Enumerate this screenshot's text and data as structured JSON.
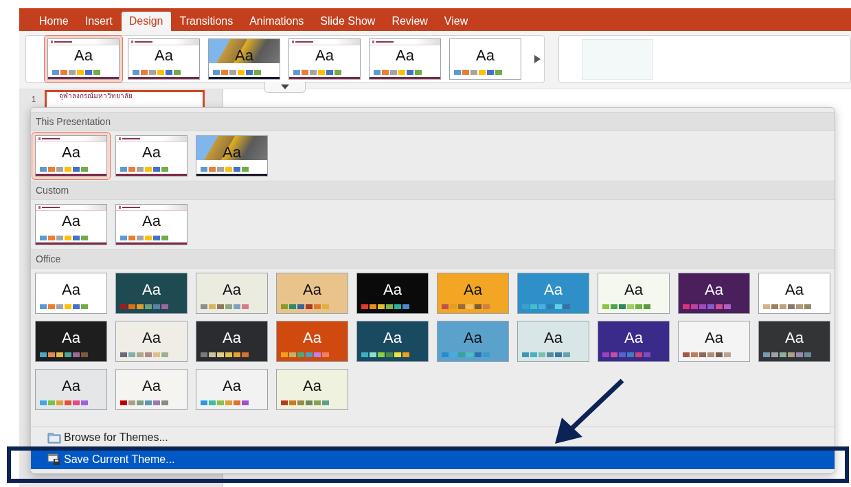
{
  "tabs": [
    {
      "label": "Home",
      "selected": false
    },
    {
      "label": "Insert",
      "selected": false
    },
    {
      "label": "Design",
      "selected": true
    },
    {
      "label": "Transitions",
      "selected": false
    },
    {
      "label": "Animations",
      "selected": false
    },
    {
      "label": "Slide Show",
      "selected": false
    },
    {
      "label": "Review",
      "selected": false
    },
    {
      "label": "View",
      "selected": false
    }
  ],
  "ribbon": {
    "themes": [
      {
        "label": "Aa",
        "kind": "template",
        "color": "#ffffff",
        "palette": [
          {
            "color": "#5b9bd5"
          },
          {
            "color": "#ed7d31"
          },
          {
            "color": "#a5a5a5"
          },
          {
            "color": "#ffc000"
          },
          {
            "color": "#4472c4"
          },
          {
            "color": "#70ad47"
          }
        ],
        "selected": true
      },
      {
        "label": "Aa",
        "kind": "template",
        "color": "#ffffff",
        "palette": [
          {
            "color": "#5b9bd5"
          },
          {
            "color": "#ed7d31"
          },
          {
            "color": "#a5a5a5"
          },
          {
            "color": "#ffc000"
          },
          {
            "color": "#4472c4"
          },
          {
            "color": "#70ad47"
          }
        ],
        "selected": false
      },
      {
        "label": "Aa",
        "kind": "photo",
        "palette": [
          {
            "color": "#5b9bd5"
          },
          {
            "color": "#ed7d31"
          },
          {
            "color": "#a5a5a5"
          },
          {
            "color": "#ffc000"
          },
          {
            "color": "#4472c4"
          },
          {
            "color": "#70ad47"
          }
        ],
        "selected": false
      },
      {
        "label": "Aa",
        "kind": "template",
        "color": "#ffffff",
        "palette": [
          {
            "color": "#5b9bd5"
          },
          {
            "color": "#ed7d31"
          },
          {
            "color": "#a5a5a5"
          },
          {
            "color": "#ffc000"
          },
          {
            "color": "#4472c4"
          },
          {
            "color": "#70ad47"
          }
        ],
        "selected": false
      },
      {
        "label": "Aa",
        "kind": "template",
        "color": "#ffffff",
        "palette": [
          {
            "color": "#5b9bd5"
          },
          {
            "color": "#ed7d31"
          },
          {
            "color": "#a5a5a5"
          },
          {
            "color": "#ffc000"
          },
          {
            "color": "#4472c4"
          },
          {
            "color": "#70ad47"
          }
        ],
        "selected": false
      },
      {
        "label": "Aa",
        "kind": "plain",
        "color": "#ffffff",
        "palette": [
          {
            "color": "#5b9bd5"
          },
          {
            "color": "#ed7d31"
          },
          {
            "color": "#a5a5a5"
          },
          {
            "color": "#ffc000"
          },
          {
            "color": "#4472c4"
          },
          {
            "color": "#70ad47"
          }
        ],
        "selected": false
      }
    ]
  },
  "slide_panel": {
    "number": "1",
    "slide_title": "จุฬาลงกรณ์มหาวิทยาลัย"
  },
  "theme_gallery": {
    "sections": [
      {
        "title": "This Presentation",
        "themes": [
          {
            "label": "Aa",
            "kind": "template",
            "color": "#ffffff",
            "palette": [
              {
                "color": "#5b9bd5"
              },
              {
                "color": "#ed7d31"
              },
              {
                "color": "#a5a5a5"
              },
              {
                "color": "#ffc000"
              },
              {
                "color": "#4472c4"
              },
              {
                "color": "#70ad47"
              }
            ],
            "selected": true
          },
          {
            "label": "Aa",
            "kind": "template",
            "color": "#ffffff",
            "palette": [
              {
                "color": "#5b9bd5"
              },
              {
                "color": "#ed7d31"
              },
              {
                "color": "#a5a5a5"
              },
              {
                "color": "#ffc000"
              },
              {
                "color": "#4472c4"
              },
              {
                "color": "#70ad47"
              }
            ],
            "selected": false
          },
          {
            "label": "Aa",
            "kind": "photo",
            "palette": [
              {
                "color": "#5b9bd5"
              },
              {
                "color": "#ed7d31"
              },
              {
                "color": "#a5a5a5"
              },
              {
                "color": "#ffc000"
              },
              {
                "color": "#4472c4"
              },
              {
                "color": "#70ad47"
              }
            ],
            "selected": false
          }
        ]
      },
      {
        "title": "Custom",
        "themes": [
          {
            "label": "Aa",
            "kind": "template",
            "color": "#ffffff",
            "palette": [
              {
                "color": "#5b9bd5"
              },
              {
                "color": "#ed7d31"
              },
              {
                "color": "#a5a5a5"
              },
              {
                "color": "#ffc000"
              },
              {
                "color": "#4472c4"
              },
              {
                "color": "#70ad47"
              }
            ],
            "selected": false
          },
          {
            "label": "Aa",
            "kind": "template",
            "color": "#ffffff",
            "palette": [
              {
                "color": "#5b9bd5"
              },
              {
                "color": "#ed7d31"
              },
              {
                "color": "#a5a5a5"
              },
              {
                "color": "#ffc000"
              },
              {
                "color": "#4472c4"
              },
              {
                "color": "#70ad47"
              }
            ],
            "selected": false
          }
        ]
      },
      {
        "title": "Office",
        "themes": [
          {
            "label": "Aa",
            "kind": "plain",
            "color": "#ffffff",
            "palette": [
              {
                "color": "#5b9bd5"
              },
              {
                "color": "#ed7d31"
              },
              {
                "color": "#a5a5a5"
              },
              {
                "color": "#ffc000"
              },
              {
                "color": "#4472c4"
              },
              {
                "color": "#70ad47"
              }
            ],
            "selected": false
          },
          {
            "label": "Aa",
            "kind": "plain",
            "color": "#1e4a52",
            "palette": [
              {
                "color": "#a31c1c"
              },
              {
                "color": "#e46c0a"
              },
              {
                "color": "#d8a02a"
              },
              {
                "color": "#6aa37b"
              },
              {
                "color": "#5b82a1"
              },
              {
                "color": "#a463a3"
              }
            ],
            "selected": false
          },
          {
            "label": "Aa",
            "kind": "plain",
            "color": "#ecebe0",
            "palette": [
              {
                "color": "#8e8e8e"
              },
              {
                "color": "#dbb35f"
              },
              {
                "color": "#8c7a5b"
              },
              {
                "color": "#8fa77f"
              },
              {
                "color": "#7ea2bf"
              },
              {
                "color": "#d97a8a"
              }
            ],
            "selected": false
          },
          {
            "label": "Aa",
            "kind": "plain",
            "color": "#e8c48c",
            "palette": [
              {
                "color": "#8c9a2a"
              },
              {
                "color": "#2f8a6b"
              },
              {
                "color": "#3b63a0"
              },
              {
                "color": "#a93a2a"
              },
              {
                "color": "#e07a2a"
              },
              {
                "color": "#e0b040"
              }
            ],
            "selected": false
          },
          {
            "label": "Aa",
            "kind": "plain",
            "color": "#0a0a0a",
            "palette": [
              {
                "color": "#e23b2b"
              },
              {
                "color": "#f28a1a"
              },
              {
                "color": "#e0c02a"
              },
              {
                "color": "#7ab94a"
              },
              {
                "color": "#2ab0a0"
              },
              {
                "color": "#4a8ad0"
              }
            ],
            "selected": false
          },
          {
            "label": "Aa",
            "kind": "plain",
            "color": "#f2a623",
            "palette": [
              {
                "color": "#c0504d"
              },
              {
                "color": "#e0a020"
              },
              {
                "color": "#9a6a3a"
              },
              {
                "color": "#f0c060"
              },
              {
                "color": "#7a5a3a"
              },
              {
                "color": "#d08040"
              }
            ],
            "selected": false
          },
          {
            "label": "Aa",
            "kind": "plain",
            "color": "#2f8fc8",
            "palette": [
              {
                "color": "#3aa0d0"
              },
              {
                "color": "#40c0c0"
              },
              {
                "color": "#4ab0e0"
              },
              {
                "color": "#2a80b0"
              },
              {
                "color": "#60d0e0"
              },
              {
                "color": "#3a70a0"
              }
            ],
            "selected": false
          },
          {
            "label": "Aa",
            "kind": "plain",
            "color": "#f4f8ee",
            "palette": [
              {
                "color": "#8cc63f"
              },
              {
                "color": "#4aa84a"
              },
              {
                "color": "#2a8a5a"
              },
              {
                "color": "#a0d060"
              },
              {
                "color": "#70b040"
              },
              {
                "color": "#5a9a3a"
              }
            ],
            "selected": false
          },
          {
            "label": "Aa",
            "kind": "plain",
            "color": "#4a1f5c",
            "palette": [
              {
                "color": "#e0307a"
              },
              {
                "color": "#c040a0"
              },
              {
                "color": "#a04ac0"
              },
              {
                "color": "#8a5ad0"
              },
              {
                "color": "#d05090"
              },
              {
                "color": "#b060c0"
              }
            ],
            "selected": false
          },
          {
            "label": "Aa",
            "kind": "plain",
            "color": "#ffffff",
            "palette": [
              {
                "color": "#d8b08a"
              },
              {
                "color": "#a08060"
              },
              {
                "color": "#c0a080"
              },
              {
                "color": "#8a7a6a"
              },
              {
                "color": "#b09a7a"
              },
              {
                "color": "#98886a"
              }
            ],
            "selected": false
          },
          {
            "label": "Aa",
            "kind": "plain",
            "color": "#1e1e1e",
            "palette": [
              {
                "color": "#4aa8c0"
              },
              {
                "color": "#e38a4a"
              },
              {
                "color": "#e3b84a"
              },
              {
                "color": "#4aa89a"
              },
              {
                "color": "#9a6a9a"
              },
              {
                "color": "#7a5a3a"
              }
            ],
            "selected": false
          },
          {
            "label": "Aa",
            "kind": "plain",
            "color": "#efede6",
            "palette": [
              {
                "color": "#6a6a7a"
              },
              {
                "color": "#7fb0a8"
              },
              {
                "color": "#b0a88a"
              },
              {
                "color": "#b08a8a"
              },
              {
                "color": "#e0c08a"
              },
              {
                "color": "#a0b08a"
              }
            ],
            "selected": false
          },
          {
            "label": "Aa",
            "kind": "plain",
            "color": "#2a2c30",
            "palette": [
              {
                "color": "#7a7a7a"
              },
              {
                "color": "#c8c4a0"
              },
              {
                "color": "#e0d080"
              },
              {
                "color": "#e8c050"
              },
              {
                "color": "#e8a030"
              },
              {
                "color": "#d87030"
              }
            ],
            "selected": false
          },
          {
            "label": "Aa",
            "kind": "plain",
            "color": "#d04a10",
            "palette": [
              {
                "color": "#f0a020"
              },
              {
                "color": "#c8b060"
              },
              {
                "color": "#4aaa7a"
              },
              {
                "color": "#4aa0c0"
              },
              {
                "color": "#c080f0"
              },
              {
                "color": "#f08060"
              }
            ],
            "selected": false
          },
          {
            "label": "Aa",
            "kind": "plain",
            "color": "#1a4a60",
            "palette": [
              {
                "color": "#3ab0c0"
              },
              {
                "color": "#8ae0d0"
              },
              {
                "color": "#8ad040"
              },
              {
                "color": "#4a8a4a"
              },
              {
                "color": "#f0e040"
              },
              {
                "color": "#f0a020"
              }
            ],
            "selected": false
          },
          {
            "label": "Aa",
            "kind": "plain",
            "color": "#5aa2cc",
            "palette": [
              {
                "color": "#2a8ad0"
              },
              {
                "color": "#40b0e0"
              },
              {
                "color": "#3aa0a0"
              },
              {
                "color": "#4ac0c0"
              },
              {
                "color": "#2a70b0"
              },
              {
                "color": "#3a9ad0"
              }
            ],
            "selected": false
          },
          {
            "label": "Aa",
            "kind": "plain",
            "color": "#d8e6e8",
            "palette": [
              {
                "color": "#3a9ab0"
              },
              {
                "color": "#4ab0c0"
              },
              {
                "color": "#7ac0b0"
              },
              {
                "color": "#5a8aa0"
              },
              {
                "color": "#3a7a9a"
              },
              {
                "color": "#6aa0b0"
              }
            ],
            "selected": false
          },
          {
            "label": "Aa",
            "kind": "plain",
            "color": "#3a2a8a",
            "palette": [
              {
                "color": "#a040c0"
              },
              {
                "color": "#c050a0"
              },
              {
                "color": "#5a60d0"
              },
              {
                "color": "#3a80c0"
              },
              {
                "color": "#d04080"
              },
              {
                "color": "#7a50c0"
              }
            ],
            "selected": false
          },
          {
            "label": "Aa",
            "kind": "plain",
            "color": "#f4f4f4",
            "palette": [
              {
                "color": "#a05a4a"
              },
              {
                "color": "#c07a5a"
              },
              {
                "color": "#8a6a5a"
              },
              {
                "color": "#b08a7a"
              },
              {
                "color": "#7a5a4a"
              },
              {
                "color": "#c0a090"
              }
            ],
            "selected": false
          },
          {
            "label": "Aa",
            "kind": "plain",
            "color": "#333436",
            "palette": [
              {
                "color": "#7a9ab0"
              },
              {
                "color": "#a0a0a0"
              },
              {
                "color": "#8ab0a0"
              },
              {
                "color": "#b0a08a"
              },
              {
                "color": "#9a8ab0"
              },
              {
                "color": "#6a8a9a"
              }
            ],
            "selected": false
          },
          {
            "label": "Aa",
            "kind": "plain",
            "color": "#e4e6e8",
            "palette": [
              {
                "color": "#3aa8e8"
              },
              {
                "color": "#7ac04a"
              },
              {
                "color": "#e0a040"
              },
              {
                "color": "#e0503a"
              },
              {
                "color": "#e04a8a"
              },
              {
                "color": "#a060e0"
              }
            ],
            "selected": false
          },
          {
            "label": "Aa",
            "kind": "plain",
            "color": "#f6f4f0",
            "palette": [
              {
                "color": "#c00000"
              },
              {
                "color": "#a8a080"
              },
              {
                "color": "#7aa08a"
              },
              {
                "color": "#5a9ab0"
              },
              {
                "color": "#9a7ab0"
              },
              {
                "color": "#8a8a8a"
              }
            ],
            "selected": false
          },
          {
            "label": "Aa",
            "kind": "plain",
            "color": "#f2f2f2",
            "palette": [
              {
                "color": "#2a9ae0"
              },
              {
                "color": "#3ac0a0"
              },
              {
                "color": "#8ac04a"
              },
              {
                "color": "#e0a030"
              },
              {
                "color": "#e07030"
              },
              {
                "color": "#a050d0"
              }
            ],
            "selected": false
          },
          {
            "label": "Aa",
            "kind": "plain",
            "color": "#f0f2e0",
            "palette": [
              {
                "color": "#b0401a"
              },
              {
                "color": "#d07a1a"
              },
              {
                "color": "#9a8a4a"
              },
              {
                "color": "#6a8a5a"
              },
              {
                "color": "#8aa050"
              },
              {
                "color": "#5aa08a"
              }
            ],
            "selected": false
          }
        ]
      }
    ],
    "commands": [
      {
        "label": "Browse for Themes...",
        "kind": "browse",
        "selected": false
      },
      {
        "label": "Save Current Theme...",
        "kind": "save",
        "selected": true
      }
    ]
  }
}
